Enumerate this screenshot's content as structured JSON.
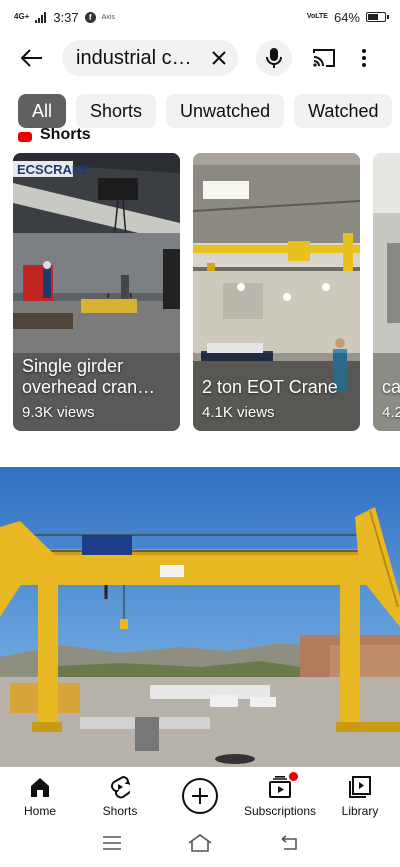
{
  "status_bar": {
    "time": "3:37",
    "network_left": "4G+",
    "app_notification_icon": "facebook-icon",
    "tiny_label": "Axis",
    "network_right": "VoLTE",
    "battery": "64%",
    "battery_level": 0.64
  },
  "search": {
    "query": "industrial c…"
  },
  "chips": [
    {
      "label": "All",
      "active": true
    },
    {
      "label": "Shorts"
    },
    {
      "label": "Unwatched"
    },
    {
      "label": "Watched"
    }
  ],
  "shorts_section": {
    "title": "Shorts"
  },
  "shorts": [
    {
      "title": "Single girder overhead cran…",
      "views": "9.3K views"
    },
    {
      "title": "2 ton EOT Crane",
      "views": "4.1K views"
    },
    {
      "title": "ca",
      "views": "4.2"
    }
  ],
  "thumbnail_text": {
    "short1_banner": "ECSCRANE"
  },
  "bottom_nav": [
    {
      "label": "Home",
      "icon": "home-icon"
    },
    {
      "label": "Shorts",
      "icon": "shorts-icon"
    },
    {
      "label": "",
      "icon": "add-icon"
    },
    {
      "label": "Subscriptions",
      "icon": "subscriptions-icon"
    },
    {
      "label": "Library",
      "icon": "library-icon"
    }
  ],
  "colors": {
    "chip_active": "#606060",
    "chip_bg": "#f2f2f2",
    "notification": "#ee0000",
    "crane_yellow": "#e8b823"
  }
}
